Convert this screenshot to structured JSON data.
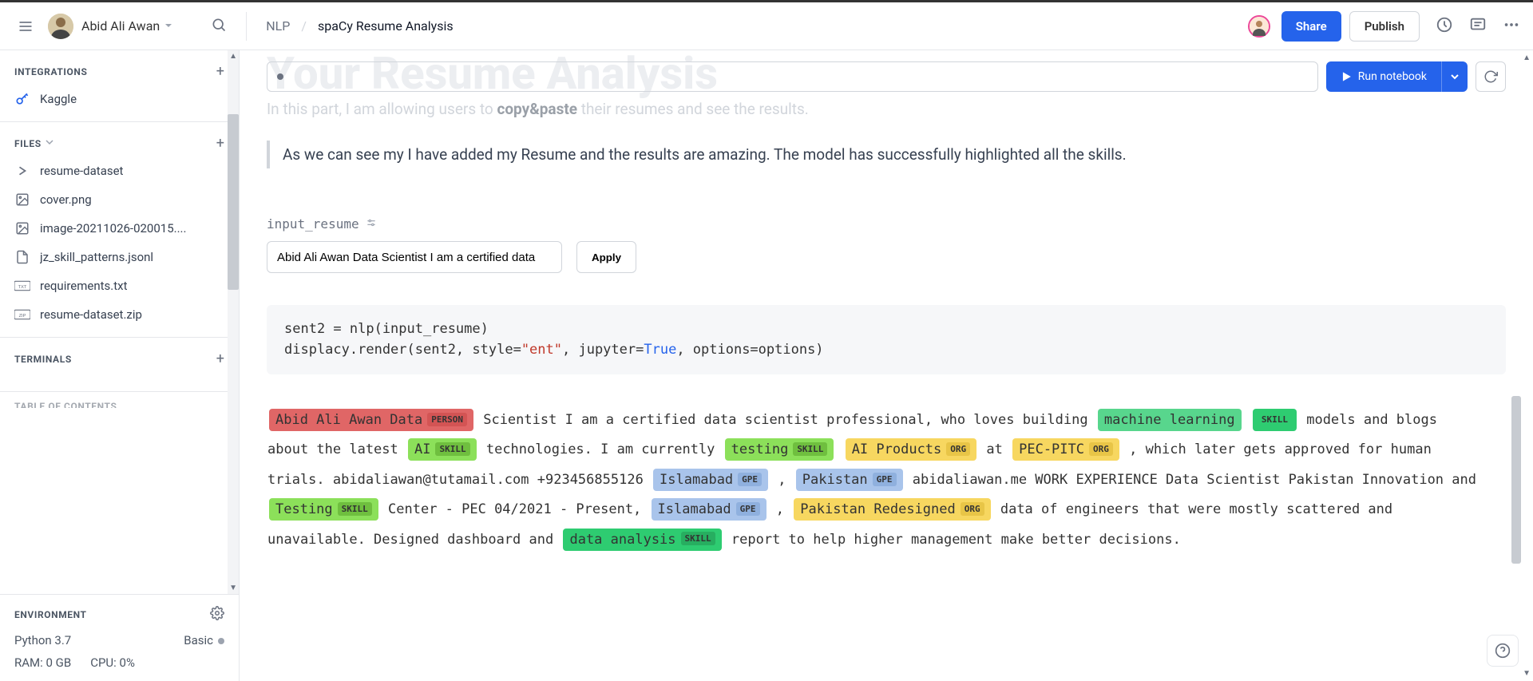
{
  "header": {
    "username": "Abid Ali Awan",
    "breadcrumb_parent": "NLP",
    "breadcrumb_current": "spaCy Resume Analysis",
    "share_label": "Share",
    "publish_label": "Publish"
  },
  "sidebar": {
    "integrations_title": "INTEGRATIONS",
    "integrations": [
      {
        "label": "Kaggle",
        "icon": "key-icon"
      }
    ],
    "files_title": "FILES",
    "files": [
      {
        "label": "resume-dataset",
        "icon": "folder-caret-icon"
      },
      {
        "label": "cover.png",
        "icon": "image-icon"
      },
      {
        "label": "image-20211026-020015....",
        "icon": "image-icon"
      },
      {
        "label": "jz_skill_patterns.jsonl",
        "icon": "file-icon"
      },
      {
        "label": "requirements.txt",
        "icon": "txt-icon"
      },
      {
        "label": "resume-dataset.zip",
        "icon": "zip-icon"
      }
    ],
    "terminals_title": "TERMINALS",
    "toc_title": "TABLE OF CONTENTS",
    "env_title": "ENVIRONMENT",
    "env_python": "Python 3.7",
    "env_tier": "Basic",
    "env_ram": "RAM: 0 GB",
    "env_cpu": "CPU: 0%"
  },
  "toolbar": {
    "run_label": "Run notebook"
  },
  "content": {
    "ghost_heading": "Your Resume Analysis",
    "para_prefix": "In this part, I am allowing users to ",
    "para_bold": "copy&paste",
    "para_suffix": " their resumes and see the results.",
    "quote": "As we can see my I have added my Resume and the results are amazing. The model has successfully highlighted all the skills.",
    "var_name": "input_resume",
    "input_value": "Abid Ali Awan Data Scientist I am a certified data",
    "apply_label": "Apply",
    "code_line1_a": "sent2 = nlp(input_resume)",
    "code_line2_a": "displacy.render(sent2, style=",
    "code_line2_str": "\"ent\"",
    "code_line2_b": ", jupyter=",
    "code_line2_bool": "True",
    "code_line2_c": ", options=options)"
  },
  "entities": {
    "labels": {
      "person": "PERSON",
      "skill": "SKILL",
      "org": "ORG",
      "gpe": "GPE"
    },
    "colors": {
      "person_bg": "#e06666",
      "person_label_bg": "#d35454",
      "skill_green_bg": "#2ecc71",
      "skill_label_bg": "#27ae60",
      "skill_lime_bg": "#8ce05a",
      "skill_lime_label": "#6fbf3f",
      "skill_teal_bg": "#16c79a",
      "org_bg": "#f7d760",
      "org_label_bg": "#e8c547",
      "gpe_bg": "#a9c4eb",
      "gpe_label_bg": "#8fb0de"
    },
    "tokens": [
      {
        "text": "Abid Ali Awan Data",
        "label": "PERSON",
        "bg": "#e06666",
        "lbg": "#d35454"
      },
      {
        "text": " Scientist I am a certified data scientist professional, who loves building "
      },
      {
        "text": "machine learning",
        "label": "SKILL",
        "bg": "#58d68d",
        "lbg": "#2ecc71",
        "label_below": true
      },
      {
        "text": " models and blogs about the latest "
      },
      {
        "text": "AI",
        "label": "SKILL",
        "bg": "#8ce05a",
        "lbg": "#6fbf3f"
      },
      {
        "text": " technologies. I am currently "
      },
      {
        "text": "testing",
        "label": "SKILL",
        "bg": "#8ce05a",
        "lbg": "#6fbf3f"
      },
      {
        "text": " "
      },
      {
        "text": "AI Products",
        "label": "ORG",
        "bg": "#f7d760",
        "lbg": "#e8c547"
      },
      {
        "text": " at "
      },
      {
        "text": "PEC-PITC",
        "label": "ORG",
        "bg": "#f7d760",
        "lbg": "#e8c547"
      },
      {
        "text": " , which later gets approved for human trials. abidaliawan@tutamail.com +923456855126 "
      },
      {
        "text": "Islamabad",
        "label": "GPE",
        "bg": "#a9c4eb",
        "lbg": "#8fb0de"
      },
      {
        "text": " , "
      },
      {
        "text": "Pakistan",
        "label": "GPE",
        "bg": "#a9c4eb",
        "lbg": "#8fb0de"
      },
      {
        "text": " abidaliawan.me WORK EXPERIENCE Data Scientist Pakistan Innovation and "
      },
      {
        "text": "Testing",
        "label": "SKILL",
        "bg": "#8ce05a",
        "lbg": "#6fbf3f"
      },
      {
        "text": " Center - PEC 04/2021 - Present, "
      },
      {
        "text": "Islamabad",
        "label": "GPE",
        "bg": "#a9c4eb",
        "lbg": "#8fb0de"
      },
      {
        "text": " , "
      },
      {
        "text": "Pakistan Redesigned",
        "label": "ORG",
        "bg": "#f7d760",
        "lbg": "#e8c547"
      },
      {
        "text": " data of engineers that were mostly scattered and unavailable. Designed dashboard and "
      },
      {
        "text": "data analysis",
        "label": "SKILL",
        "bg": "#2ecc71",
        "lbg": "#27ae60"
      },
      {
        "text": " report to help higher management make better decisions."
      }
    ]
  }
}
